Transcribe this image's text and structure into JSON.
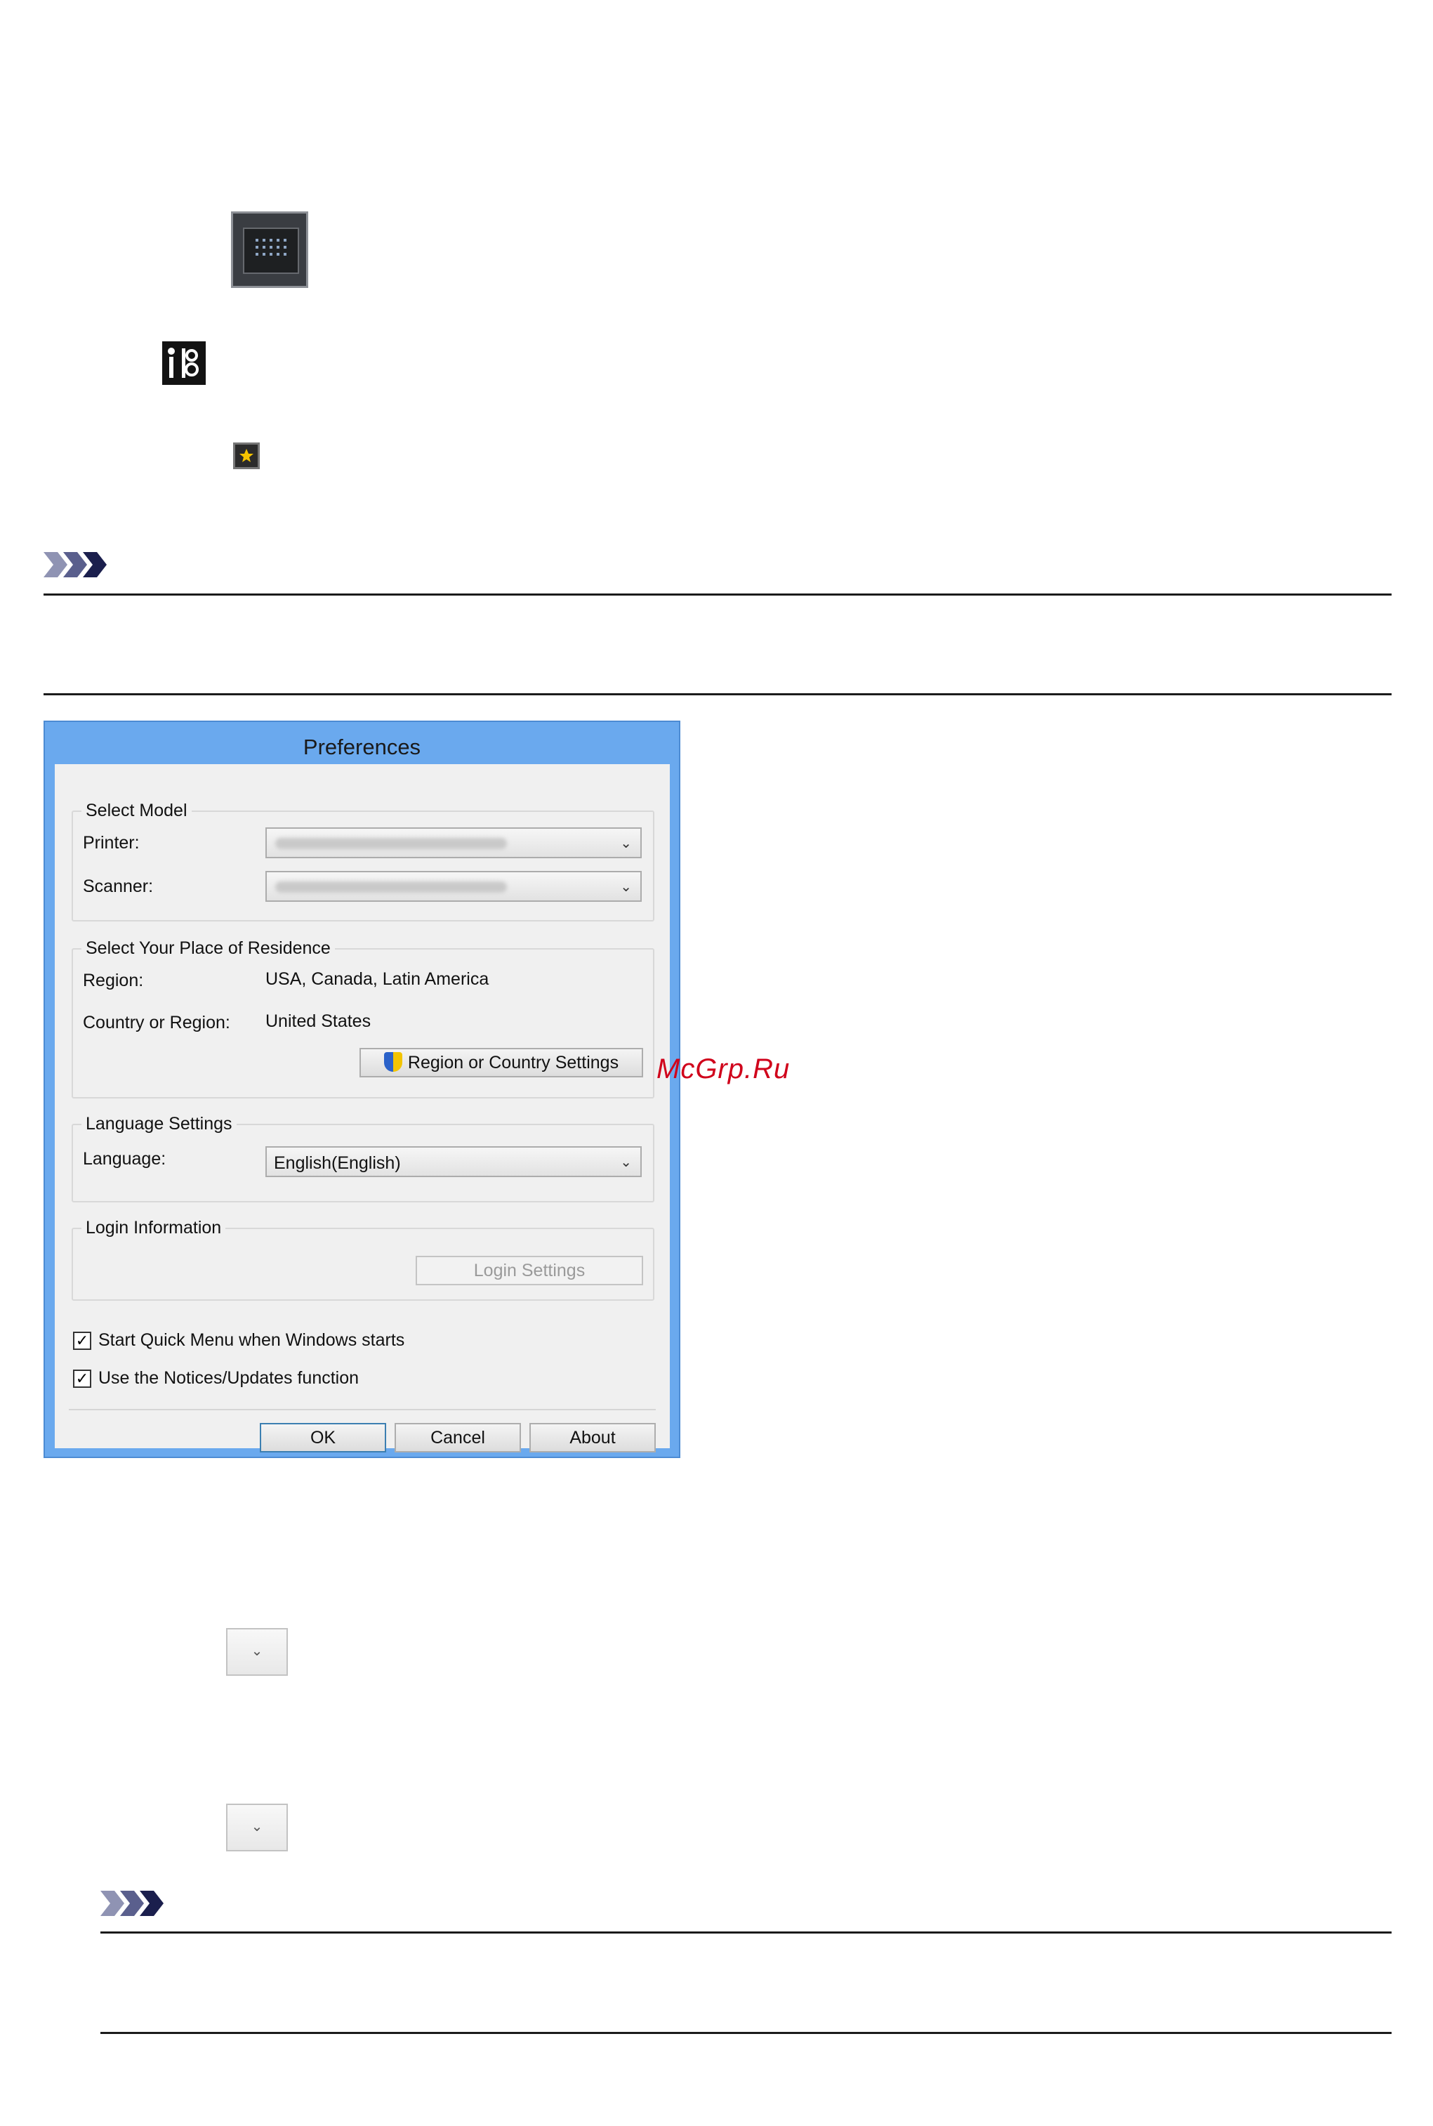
{
  "dialog": {
    "title": "Preferences",
    "select_model": {
      "title": "Select Model",
      "printer_label": "Printer:",
      "scanner_label": "Scanner:"
    },
    "residence": {
      "title": "Select Your Place of Residence",
      "region_label": "Region:",
      "region_value": "USA, Canada, Latin America",
      "country_label": "Country or Region:",
      "country_value": "United States",
      "settings_button": "Region or Country Settings"
    },
    "language": {
      "title": "Language Settings",
      "label": "Language:",
      "value": "English(English)"
    },
    "login": {
      "title": "Login Information",
      "button": "Login Settings"
    },
    "checkboxes": [
      {
        "label": "Start Quick Menu when Windows starts",
        "checked": true
      },
      {
        "label": "Use the Notices/Updates function",
        "checked": true
      }
    ],
    "buttons": {
      "ok": "OK",
      "cancel": "Cancel",
      "about": "About"
    }
  },
  "watermark": "McGrp.Ru",
  "colors": {
    "title_bar": "#6aa9ee",
    "note_chevron": "#1b1f4d",
    "watermark": "#d0021b"
  },
  "icons": [
    "quick-menu-panel-icon",
    "tools-icon",
    "star-icon",
    "note-chevron-icon",
    "shield-icon",
    "checkmark-icon",
    "chevron-down-icon"
  ]
}
